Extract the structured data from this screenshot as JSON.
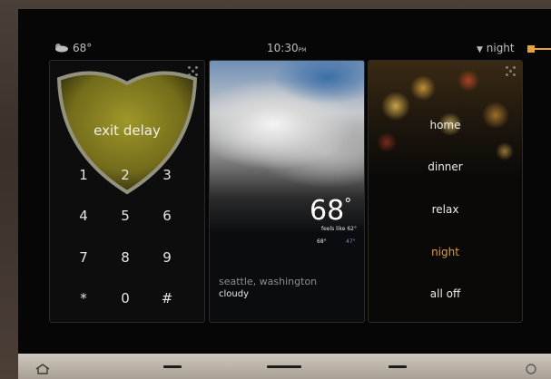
{
  "status_bar": {
    "outdoor_temp": "68°",
    "time": "10:30",
    "time_suffix": "PM",
    "mode": "night"
  },
  "security_panel": {
    "label": "exit delay",
    "keys": [
      "1",
      "2",
      "3",
      "4",
      "5",
      "6",
      "7",
      "8",
      "9",
      "*",
      "0",
      "#"
    ]
  },
  "weather_panel": {
    "temperature": "68",
    "degree_symbol": "°",
    "feels_like": "feels like 62°",
    "high": "68°",
    "low": "47°",
    "location": "seattle, washington",
    "condition": "cloudy"
  },
  "scenes_panel": {
    "items": [
      "home",
      "dinner",
      "relax",
      "night",
      "all off"
    ],
    "active": "night"
  },
  "colors": {
    "accent": "#e3a53a",
    "low_temp": "#6c93d8"
  }
}
